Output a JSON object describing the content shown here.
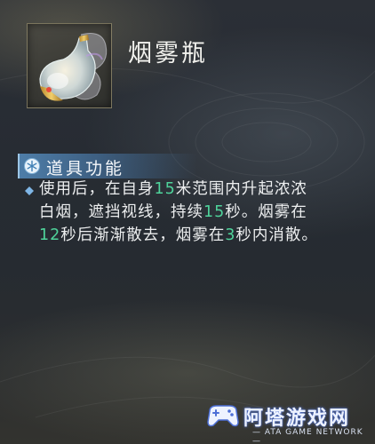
{
  "item": {
    "name": "烟雾瓶",
    "icon": "smoke-bottle-icon"
  },
  "section": {
    "title": "道具功能",
    "icon": "snowflake-icon"
  },
  "description": {
    "line1": [
      "使用后，在自身",
      "15",
      "米范围内升起浓浓"
    ],
    "line2": [
      "白烟，遮挡视线，持续",
      "15",
      "秒。烟雾在"
    ],
    "line3": [
      "12",
      "秒后渐渐散去，烟雾在",
      "3",
      "秒内消散。"
    ]
  },
  "watermark": {
    "name": "阿塔游戏网",
    "subtitle": "— ATA GAME NETWORK —",
    "logo_icon": "gamepad-logo-icon"
  },
  "colors": {
    "highlight_number": "#4fd39b",
    "section_bar": "#5082af",
    "text": "#eceeef"
  }
}
